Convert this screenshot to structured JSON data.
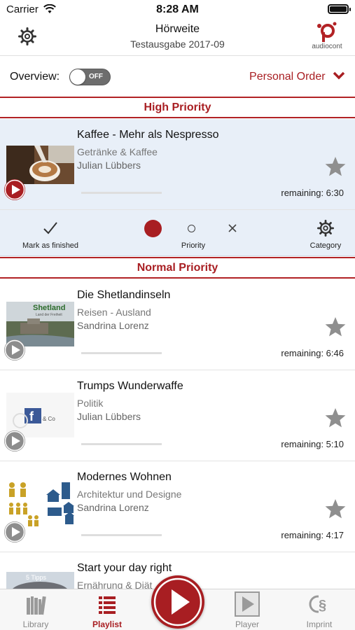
{
  "status": {
    "carrier": "Carrier",
    "time": "8:28 AM"
  },
  "header": {
    "title": "Hörweite",
    "subtitle": "Testausgabe 2017-09",
    "logo_text": "audiocont"
  },
  "overview": {
    "label": "Overview:",
    "toggle_text": "OFF",
    "toggle_on": false,
    "order_label": "Personal Order"
  },
  "sections": {
    "high": "High Priority",
    "normal": "Normal Priority"
  },
  "items": [
    {
      "title": "Kaffee - Mehr als Nespresso",
      "category": "Getränke & Kaffee",
      "author": "Julian Lübbers",
      "remaining": "remaining: 6:30",
      "progress": 0.0
    },
    {
      "title": "Die Shetlandinseln",
      "category": "Reisen - Ausland",
      "author": "Sandrina Lorenz",
      "remaining": "remaining: 6:46",
      "progress": 0.0,
      "thumb_text": "Shetland",
      "thumb_sub": "Land der Freiheit"
    },
    {
      "title": "Trumps Wunderwaffe",
      "category": "Politik",
      "author": "Julian Lübbers",
      "remaining": "remaining: 5:10",
      "progress": 0.0,
      "thumb_text": "& Co"
    },
    {
      "title": "Modernes Wohnen",
      "category": "Architektur und Designe",
      "author": "Sandrina Lorenz",
      "remaining": "remaining: 4:17",
      "progress": 0.0
    },
    {
      "title": "Start your day right",
      "category": "Ernährung & Diät",
      "thumb_text": "5 Tipps"
    }
  ],
  "actions": {
    "finished": "Mark as finished",
    "priority": "Priority",
    "category": "Category"
  },
  "tabs": {
    "library": "Library",
    "playlist": "Playlist",
    "player": "Player",
    "imprint": "Imprint"
  },
  "colors": {
    "accent": "#a81e22",
    "selected_bg": "#e8eff8"
  }
}
